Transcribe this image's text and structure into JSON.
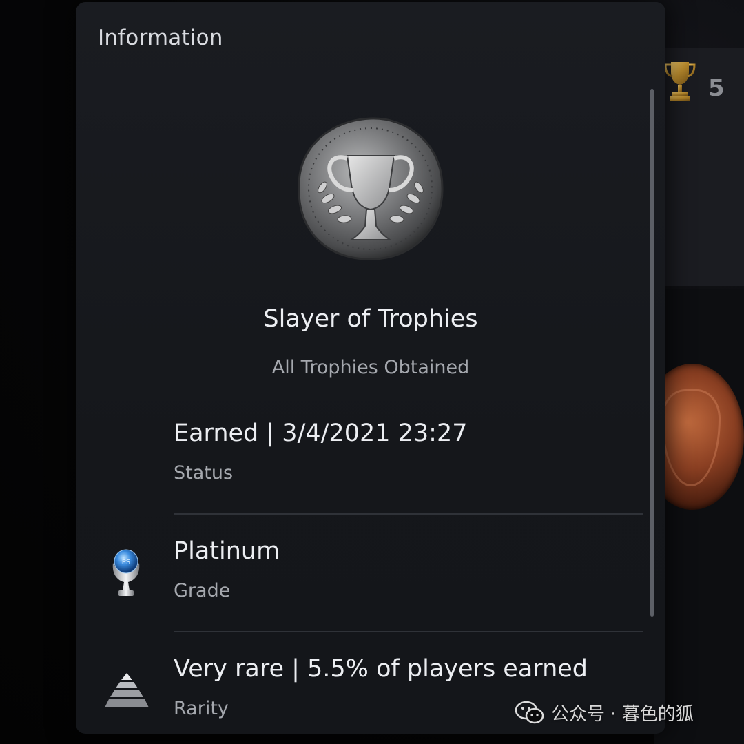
{
  "panel": {
    "title": "Information"
  },
  "trophy": {
    "name": "Slayer of Trophies",
    "description": "All Trophies Obtained",
    "icon": "trophy-coin-icon"
  },
  "details": [
    {
      "value": "Earned | 3/4/2021  23:27",
      "label": "Status",
      "icon": ""
    },
    {
      "value": "Platinum",
      "label": "Grade",
      "icon": "platinum-trophy-icon"
    },
    {
      "value": "Very rare | 5.5% of players earned",
      "label": "Rarity",
      "icon": "rarity-pyramid-icon"
    }
  ],
  "background": {
    "trophy_count": "5"
  },
  "watermark": {
    "text": "公众号 · 暮色的狐"
  },
  "colors": {
    "panel_bg": "#17191d",
    "text_primary": "#eceef2",
    "text_secondary": "#a5a8ae",
    "divider": "#2f3238",
    "gold": "#c9a043",
    "platinum_blue": "#3c8de0"
  }
}
